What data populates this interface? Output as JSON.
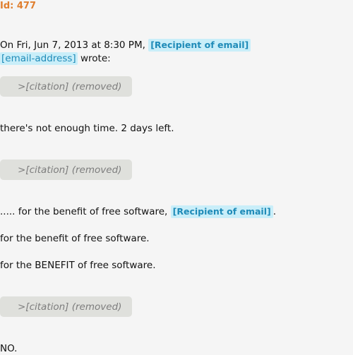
{
  "header": {
    "id_label": "Id: 477"
  },
  "message": {
    "intro_text": "On Fri, Jun 7, 2013 at 8:30 PM,",
    "recipient_tag": "[Recipient of email]",
    "email_tag": "[email-address]",
    "wrote_text": "wrote:",
    "citations": [
      ">[citation] (removed)",
      ">[citation] (removed)",
      ">[citation] (removed)"
    ],
    "line_not_enough_time": "there's not enough time. 2 days left.",
    "line_benefit_1_prefix": "..... for the benefit of free software,",
    "line_benefit_1_tag": "[Recipient of email]",
    "line_benefit_1_suffix": ".",
    "line_benefit_2": "for the benefit of free software.",
    "line_benefit_3": "for the BENEFIT of free software.",
    "line_no": "NO."
  },
  "colors": {
    "background": "#f5f5f5",
    "id_label": "#e07f2f",
    "tag_background": "#c9eef9",
    "tag_text": "#1f8bb8",
    "citation_background": "#dfe0dc",
    "citation_text": "#7d7d7d"
  }
}
